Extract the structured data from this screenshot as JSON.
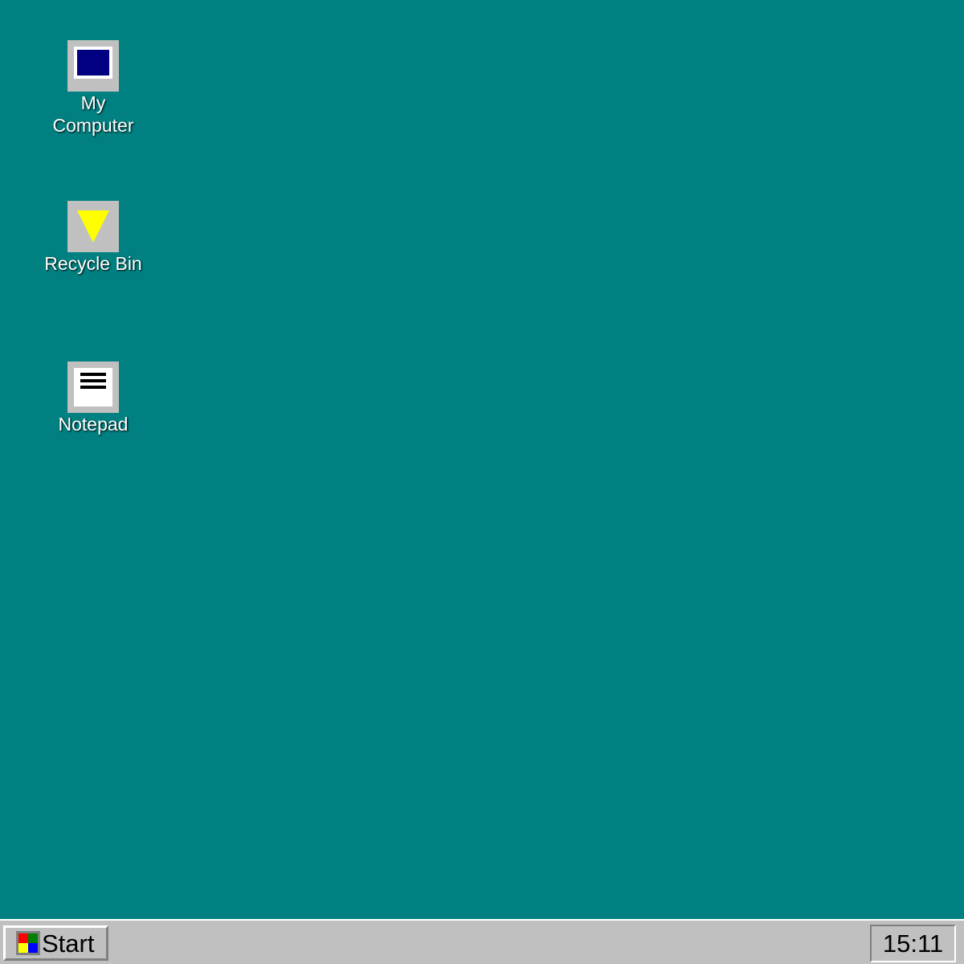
{
  "colors": {
    "desktop_background": "#008080",
    "taskbar_background": "#c0c0c0",
    "icon_tile": "#c0c0c0",
    "my_computer_screen": "#000080",
    "recycle_bin_accent": "#ffff00",
    "start_logo_colors": [
      "#ff0000",
      "#008000",
      "#ffff00",
      "#0000ff"
    ]
  },
  "desktop": {
    "icons": [
      {
        "label": "My\nComputer",
        "icon": "my-computer-icon"
      },
      {
        "label": "Recycle Bin",
        "icon": "recycle-bin-icon"
      },
      {
        "label": "Notepad",
        "icon": "notepad-icon"
      }
    ]
  },
  "taskbar": {
    "start_label": "Start",
    "start_icon": "windows-logo-icon",
    "clock": "15:11"
  }
}
